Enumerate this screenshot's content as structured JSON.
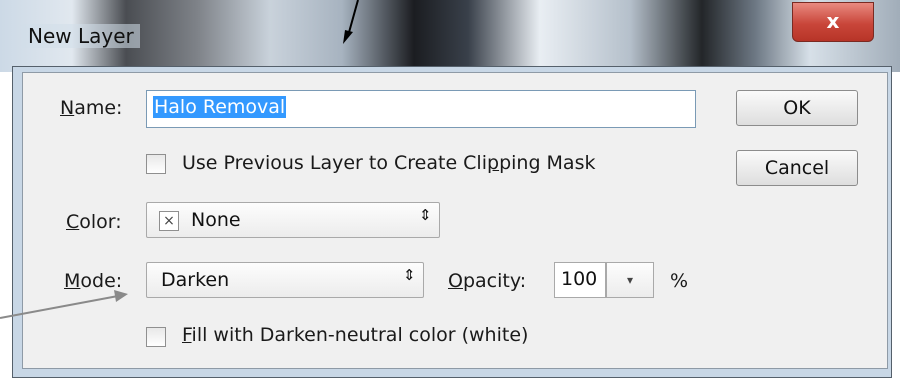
{
  "dialog": {
    "title": "New Layer",
    "close_symbol": "x",
    "name_label_key": "N",
    "name_label_rest": "ame:",
    "name_value": "Halo Removal",
    "clip_checkbox_label_a": "Use Previous Layer to Create Cli",
    "clip_checkbox_label_key": "p",
    "clip_checkbox_label_b": "ping Mask",
    "color_label_key": "C",
    "color_label_rest": "olor:",
    "color_value": "None",
    "color_swatch_symbol": "×",
    "mode_label_key": "M",
    "mode_label_rest": "ode:",
    "mode_value": "Darken",
    "opacity_label_key": "O",
    "opacity_label_rest": "pacity:",
    "opacity_value": "100",
    "opacity_unit": "%",
    "fill_checkbox_label_key": "F",
    "fill_checkbox_label_rest": "ill with Darken-neutral color (white)",
    "ok_label": "OK",
    "cancel_label": "Cancel",
    "select_arrows": "⇕",
    "dropdown_arrow": "▾"
  }
}
